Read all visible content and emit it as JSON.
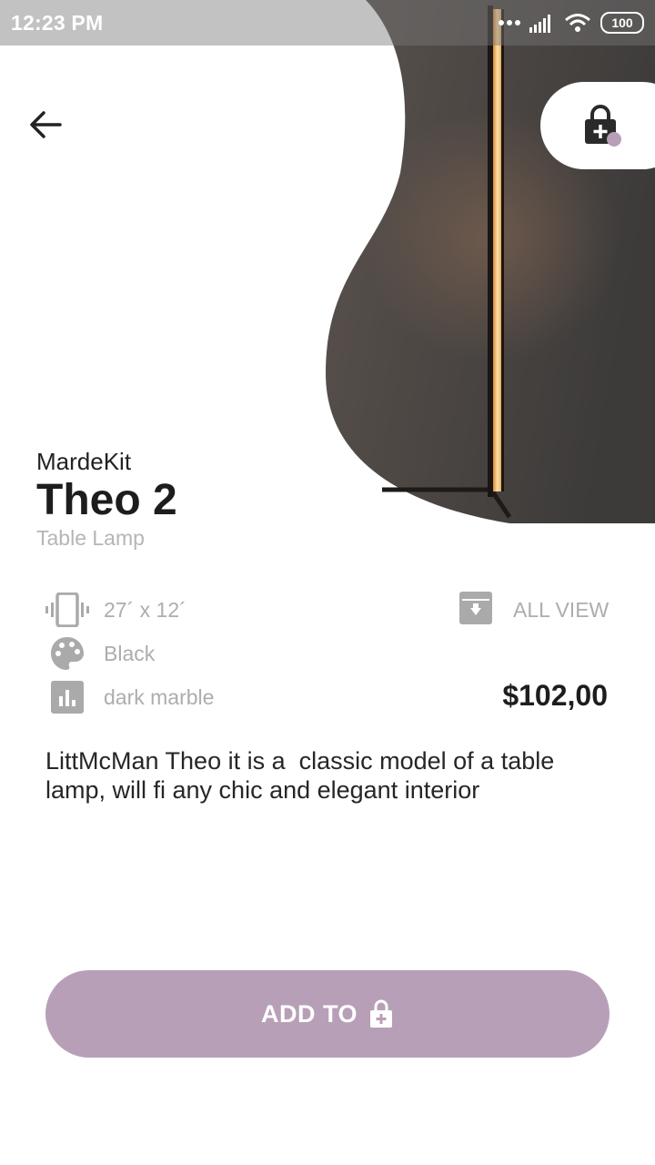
{
  "status_bar": {
    "time": "12:23 PM",
    "battery": "100"
  },
  "icons": {
    "back": "arrow-left-icon",
    "cart": "lock-plus-icon",
    "size": "vibrate-icon",
    "color": "palette-icon",
    "material": "bar-chart-icon",
    "all_view": "archive-down-icon",
    "add": "lock-plus-icon"
  },
  "colors": {
    "accent": "#b89fb8",
    "title": "#1d1d1d",
    "muted": "#adadad"
  },
  "product": {
    "brand": "MardeKit",
    "name": "Theo 2",
    "category": "Table Lamp",
    "size": "27´ x 12´",
    "color": "Black",
    "material": "dark marble",
    "price": "$102,00",
    "description": "LittMcMan Theo it is a  classic model of a table lamp, will fi any chic and elegant interior"
  },
  "actions": {
    "all_view": "ALL VIEW",
    "add_to": "ADD TO"
  }
}
